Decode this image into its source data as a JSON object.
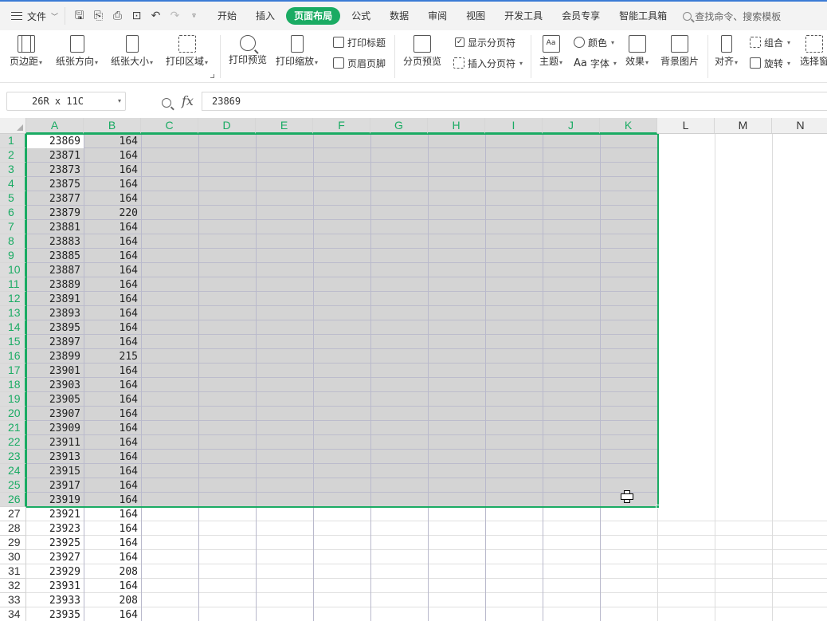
{
  "menubar": {
    "file_label": "文件",
    "tabs": [
      "开始",
      "插入",
      "页面布局",
      "公式",
      "数据",
      "审阅",
      "视图",
      "开发工具",
      "会员专享",
      "智能工具箱"
    ],
    "active_tab": "页面布局",
    "search_placeholder": "查找命令、搜索模板"
  },
  "ribbon": {
    "margins": "页边距",
    "orientation": "纸张方向",
    "size": "纸张大小",
    "print_area": "打印区域",
    "print_preview": "打印预览",
    "print_scale": "打印缩放",
    "print_titles": "打印标题",
    "header_footer": "页眉页脚",
    "page_break_preview": "分页预览",
    "show_page_breaks": "显示分页符",
    "insert_page_break": "插入分页符",
    "theme": "主题",
    "colors": "颜色",
    "fonts": "字体",
    "fonts_prefix": "Aa",
    "effects": "效果",
    "background": "背景图片",
    "align": "对齐",
    "group": "组合",
    "rotate": "旋转",
    "selection_pane": "选择窗"
  },
  "formula_bar": {
    "name_box": "26R x 11C",
    "fx": "fx",
    "value": "23869"
  },
  "sheet": {
    "columns": [
      "A",
      "B",
      "C",
      "D",
      "E",
      "F",
      "G",
      "H",
      "I",
      "J",
      "K",
      "L",
      "M",
      "N"
    ],
    "rows": [
      [
        "1",
        "23869",
        "164"
      ],
      [
        "2",
        "23871",
        "164"
      ],
      [
        "3",
        "23873",
        "164"
      ],
      [
        "4",
        "23875",
        "164"
      ],
      [
        "5",
        "23877",
        "164"
      ],
      [
        "6",
        "23879",
        "220"
      ],
      [
        "7",
        "23881",
        "164"
      ],
      [
        "8",
        "23883",
        "164"
      ],
      [
        "9",
        "23885",
        "164"
      ],
      [
        "10",
        "23887",
        "164"
      ],
      [
        "11",
        "23889",
        "164"
      ],
      [
        "12",
        "23891",
        "164"
      ],
      [
        "13",
        "23893",
        "164"
      ],
      [
        "14",
        "23895",
        "164"
      ],
      [
        "15",
        "23897",
        "164"
      ],
      [
        "16",
        "23899",
        "215"
      ],
      [
        "17",
        "23901",
        "164"
      ],
      [
        "18",
        "23903",
        "164"
      ],
      [
        "19",
        "23905",
        "164"
      ],
      [
        "20",
        "23907",
        "164"
      ],
      [
        "21",
        "23909",
        "164"
      ],
      [
        "22",
        "23911",
        "164"
      ],
      [
        "23",
        "23913",
        "164"
      ],
      [
        "24",
        "23915",
        "164"
      ],
      [
        "25",
        "23917",
        "164"
      ],
      [
        "26",
        "23919",
        "164"
      ],
      [
        "27",
        "23921",
        "164"
      ],
      [
        "28",
        "23923",
        "164"
      ],
      [
        "29",
        "23925",
        "164"
      ],
      [
        "30",
        "23927",
        "164"
      ],
      [
        "31",
        "23929",
        "208"
      ],
      [
        "32",
        "23931",
        "164"
      ],
      [
        "33",
        "23933",
        "208"
      ],
      [
        "34",
        "23935",
        "164"
      ]
    ],
    "selected_rows": 26,
    "selected_cols": 11
  },
  "colors": {
    "accent": "#1aab63",
    "selection": "#d4d4d4"
  }
}
